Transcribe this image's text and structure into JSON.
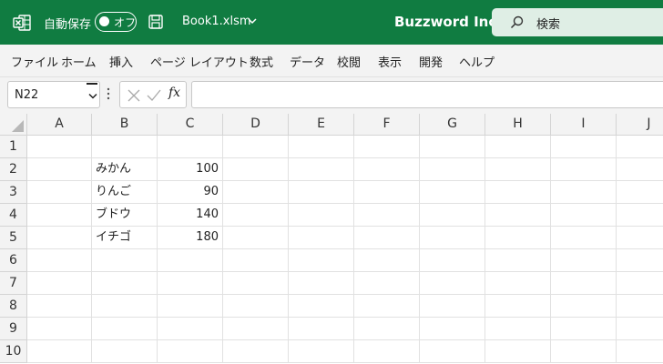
{
  "titlebar": {
    "autosave_label": "自動保存",
    "autosave_state": "オフ",
    "filename": "Book1.xlsm",
    "company": "Buzzword Inc.",
    "search_placeholder": "検索",
    "accent_color": "#107c41"
  },
  "menu": {
    "items": [
      "ファイル",
      "ホーム",
      "挿入",
      "ページ レイアウト",
      "数式",
      "データ",
      "校閲",
      "表示",
      "開発",
      "ヘルプ"
    ]
  },
  "formula_bar": {
    "name_box": "N22",
    "fx_label": "fx",
    "formula": ""
  },
  "sheet": {
    "columns": [
      "A",
      "B",
      "C",
      "D",
      "E",
      "F",
      "G",
      "H",
      "I",
      "J"
    ],
    "rows": [
      "1",
      "2",
      "3",
      "4",
      "5",
      "6",
      "7",
      "8",
      "9",
      "10"
    ],
    "cells": {
      "B2": "みかん",
      "C2": "100",
      "B3": "りんご",
      "C3": "90",
      "B4": "ブドウ",
      "C4": "140",
      "B5": "イチゴ",
      "C5": "180"
    }
  }
}
